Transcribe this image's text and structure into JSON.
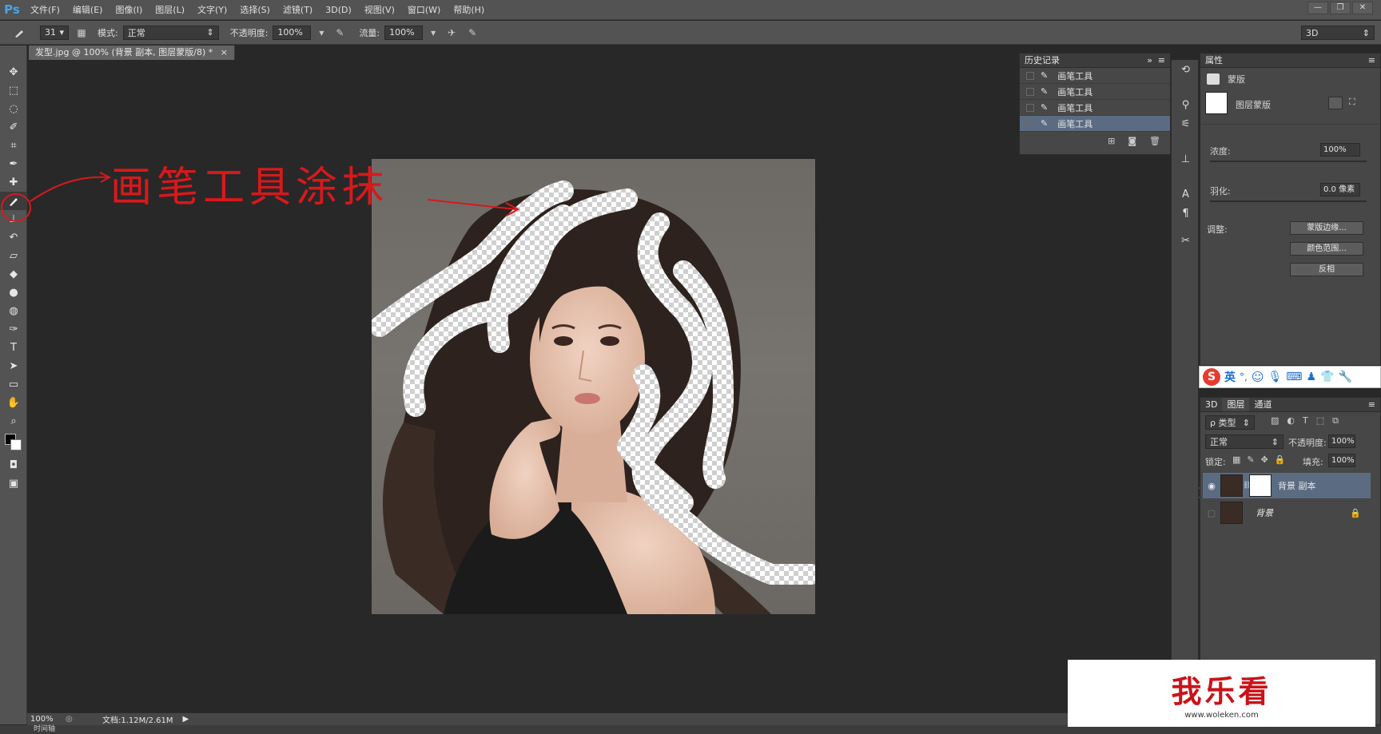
{
  "app": {
    "logo": "Ps"
  },
  "menu": [
    "文件(F)",
    "编辑(E)",
    "图像(I)",
    "图层(L)",
    "文字(Y)",
    "选择(S)",
    "滤镜(T)",
    "3D(D)",
    "视图(V)",
    "窗口(W)",
    "帮助(H)"
  ],
  "window_controls": {
    "minimize": "—",
    "restore": "❐",
    "close": "✕"
  },
  "options": {
    "brush_size": "31",
    "mode_label": "模式:",
    "mode_value": "正常",
    "opacity_label": "不透明度:",
    "opacity_value": "100%",
    "flow_label": "流量:",
    "flow_value": "100%",
    "workspace": "3D"
  },
  "document_tab": {
    "title": "发型.jpg @ 100% (背景 副本, 图层蒙版/8) *",
    "close": "×"
  },
  "annotation": {
    "text": "画笔工具涂抹"
  },
  "history": {
    "title": "历史记录",
    "items": [
      "画笔工具",
      "画笔工具",
      "画笔工具",
      "画笔工具"
    ],
    "active_index": 3
  },
  "properties": {
    "title": "属性",
    "section": "蒙版",
    "mask_label": "图层蒙版",
    "density_label": "浓度:",
    "density_value": "100%",
    "feather_label": "羽化:",
    "feather_value": "0.0 像素",
    "adjust_label": "调整:",
    "buttons": [
      "蒙版边缘...",
      "颜色范围...",
      "反相"
    ]
  },
  "ime": {
    "lang": "英",
    "punct": "°,"
  },
  "layers": {
    "tabs": [
      "3D",
      "图层",
      "通道"
    ],
    "active_tab": 1,
    "filter_label": "ρ 类型",
    "blend_mode": "正常",
    "opacity_label": "不透明度:",
    "opacity_value": "100%",
    "lock_label": "锁定:",
    "fill_label": "填充:",
    "fill_value": "100%",
    "items": [
      {
        "name": "背景 副本",
        "visible": true,
        "selected": true
      },
      {
        "name": "背景",
        "visible": false,
        "selected": false
      }
    ]
  },
  "status": {
    "zoom": "100%",
    "doc": "文档:1.12M/2.61M"
  },
  "bottom": {
    "tab": "时间轴"
  },
  "watermark": {
    "text": "我乐看",
    "url": "www.woleken.com"
  },
  "colors": {
    "accent": "#4aa3e8",
    "annotation_red": "#d7191c",
    "selected_layer": "#5b6c82"
  }
}
